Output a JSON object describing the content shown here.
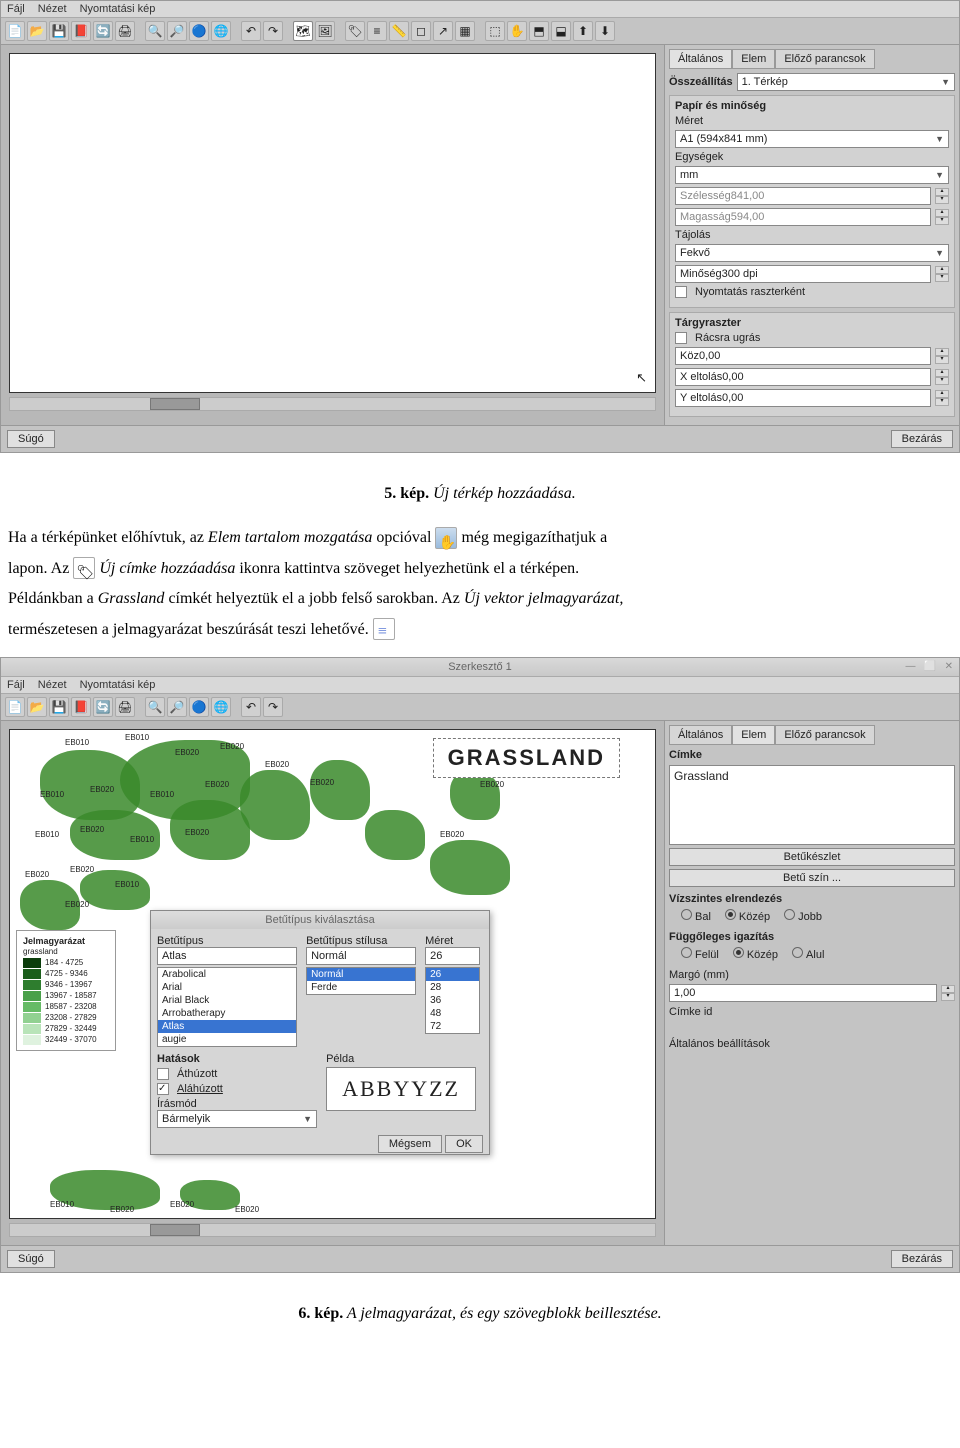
{
  "menubar": {
    "file": "Fájl",
    "view": "Nézet",
    "print": "Nyomtatási kép"
  },
  "s1": {
    "tabs": {
      "general": "Általános",
      "elem": "Elem",
      "prev": "Előző parancsok"
    },
    "compose_label": "Összeállítás",
    "compose_value": "1. Térkép",
    "paper": {
      "title": "Papír és minőség",
      "size_label": "Méret",
      "size_value": "A1 (594x841 mm)",
      "units_label": "Egységek",
      "units_value": "mm",
      "width": "Szélesség841,00",
      "height": "Magasság594,00",
      "orient_label": "Tájolás",
      "orient_value": "Fekvő",
      "quality": "Minőség300 dpi",
      "raster": "Nyomtatás raszterként"
    },
    "grid": {
      "title": "Tárgyraszter",
      "snap": "Rácsra ugrás",
      "spacing": "Köz0,00",
      "xoff": "X eltolás0,00",
      "yoff": "Y eltolás0,00"
    },
    "help": "Súgó",
    "close": "Bezárás"
  },
  "prose": {
    "cap5_num": "5. kép.",
    "cap5_text": " Új térkép hozzáadása.",
    "p1a": "Ha a térképünket előhívtuk, az ",
    "p1b": "Elem tartalom mozgatása",
    "p1c": " opcióval ",
    "p1d": " még megigazíthatjuk a",
    "p2a": "lapon. Az ",
    "p2b": " ",
    "p2c": "Új címke hozzáadása",
    "p2d": " ikonra kattintva szöveget helyezhetünk el a térképen.",
    "p3a": "Példánkban a ",
    "p3b": "Grassland",
    "p3c": " címkét helyeztük el a jobb felső sarokban. Az ",
    "p3d": "Új vektor jelmagyarázat,",
    "p4": "természetesen a jelmagyarázat beszúrását teszi lehetővé. ",
    "cap6_num": "6. kép.",
    "cap6_text": " A jelmagyarázat, és egy szövegblokk beillesztése."
  },
  "s2": {
    "wintitle": "Szerkesztő 1",
    "grassland": "GRASSLAND",
    "tabs": {
      "general": "Általános",
      "elem": "Elem",
      "prev": "Előző parancsok"
    },
    "label_section": "Címke",
    "label_value": "Grassland",
    "font_btn": "Betűkészlet",
    "color_btn": "Betű szín ...",
    "halign": "Vízszintes elrendezés",
    "bal": "Bal",
    "kozep": "Közép",
    "jobb": "Jobb",
    "valign": "Függőleges igazítás",
    "felul": "Felül",
    "alul": "Alul",
    "margin": "Margó (mm)",
    "margin_val": "1,00",
    "cid": "Címke id",
    "gensettings": "Általános beállítások",
    "help": "Súgó",
    "close": "Bezárás",
    "legend": {
      "title": "Jelmagyarázat",
      "sub": "grassland",
      "rows": [
        {
          "c": "#0b3d0b",
          "t": "184 - 4725"
        },
        {
          "c": "#1b5e1b",
          "t": "4725 - 9346"
        },
        {
          "c": "#2e7d2e",
          "t": "9346 - 13967"
        },
        {
          "c": "#49a049",
          "t": "13967 - 18587"
        },
        {
          "c": "#66bb66",
          "t": "18587 - 23208"
        },
        {
          "c": "#91d191",
          "t": "23208 - 27829"
        },
        {
          "c": "#b9e4b9",
          "t": "27829 - 32449"
        },
        {
          "c": "#dff2df",
          "t": "32449 - 37070"
        }
      ]
    },
    "dlg": {
      "title": "Betűtípus kiválasztása",
      "font": "Betűtípus",
      "style": "Betűtípus stílusa",
      "size": "Méret",
      "font_val": "Atlas",
      "style_val": "Normál",
      "size_val": "26",
      "fonts": [
        "Arabolical",
        "Arial",
        "Arial Black",
        "Arrobatherapy",
        "Atlas",
        "augie"
      ],
      "styles": [
        "Normál",
        "Ferde"
      ],
      "sizes": [
        "26",
        "28",
        "36",
        "48",
        "72"
      ],
      "effects": "Hatások",
      "strike": "Áthúzott",
      "under": "Aláhúzott",
      "script": "Írásmód",
      "script_val": "Bármelyik",
      "sample_label": "Példa",
      "sample": "ABBYYZZ",
      "cancel": "Mégsem",
      "ok": "OK"
    }
  }
}
